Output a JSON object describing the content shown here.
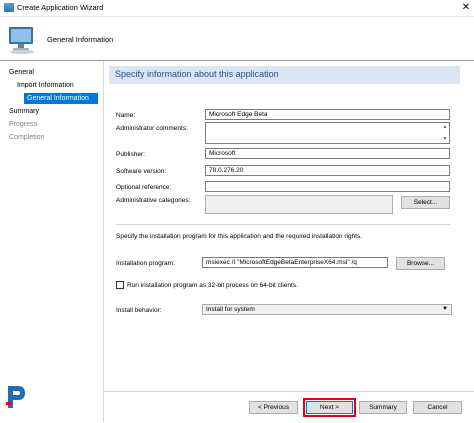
{
  "window": {
    "title": "Create Application Wizard",
    "close_glyph": "✕",
    "icon": "app-window-icon"
  },
  "header": {
    "subtitle": "General Information",
    "icon": "computer-wizard-icon"
  },
  "sidebar": {
    "items": [
      {
        "label": "General"
      },
      {
        "label": "Import Information"
      },
      {
        "label": "General Information"
      },
      {
        "label": "Summary"
      },
      {
        "label": "Progress"
      },
      {
        "label": "Completion"
      }
    ]
  },
  "main": {
    "banner": "Specify information about this application",
    "fields": {
      "name": {
        "label": "Name:",
        "value": "Microsoft Edge Beta"
      },
      "admin_comments": {
        "label": "Administrator comments:",
        "value": ""
      },
      "publisher": {
        "label": "Publisher:",
        "value": "Microsoft"
      },
      "software_version": {
        "label": "Software version:",
        "value": "78.0.276.20"
      },
      "optional_reference": {
        "label": "Optional reference:",
        "value": ""
      },
      "admin_categories": {
        "label": "Administrative categories:",
        "value": "",
        "button": "Select..."
      }
    },
    "install_instructions": "Specify the installation program for this application and the required installation rights.",
    "installation_program": {
      "label": "Installation program:",
      "value": "msiexec /I \"MicrosoftEdgeBetaEnterpriseX64.msi\" /q",
      "button": "Browse..."
    },
    "checkbox_32bit": {
      "label": "Run installation program as 32-bit process on 64-bit clients.",
      "checked": false
    },
    "install_behavior": {
      "label": "Install behavior:",
      "value": "Install for system"
    }
  },
  "footer": {
    "previous": "< Previous",
    "next": "Next >",
    "summary": "Summary",
    "cancel": "Cancel"
  },
  "colors": {
    "accent": "#0078d7",
    "banner_bg": "#dce6f2",
    "banner_text": "#1f4e96",
    "highlight": "#e0001b"
  }
}
